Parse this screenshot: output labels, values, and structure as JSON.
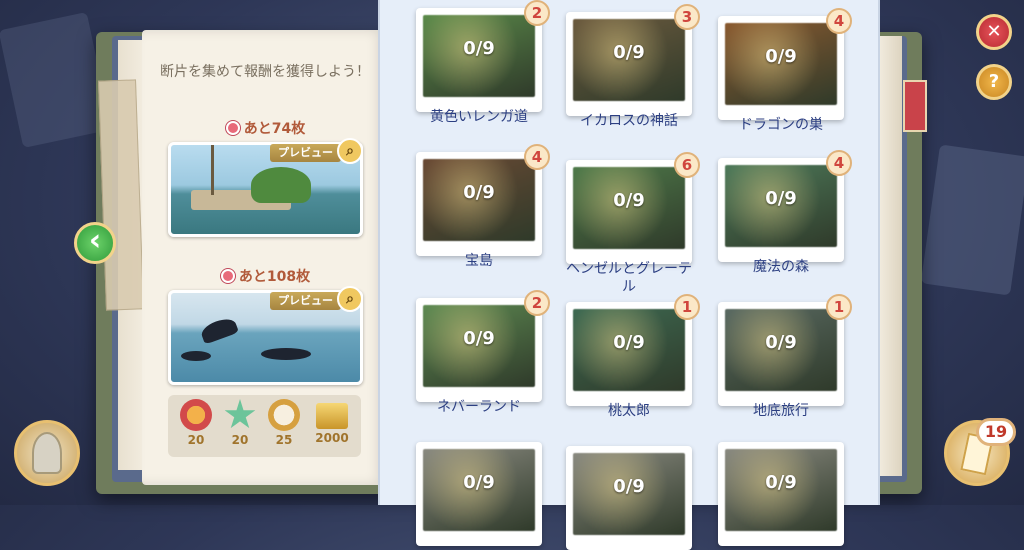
{
  "intro_text": "断片を集めて報酬を獲得しよう！",
  "packs": [
    {
      "count_label": "あと74枚",
      "preview_label": "プレビュー"
    },
    {
      "count_label": "あと108枚",
      "preview_label": "プレビュー"
    }
  ],
  "rewards": [
    {
      "icon": "mask-icon",
      "value": "20"
    },
    {
      "icon": "star-icon",
      "value": "20"
    },
    {
      "icon": "compass-icon",
      "value": "25"
    },
    {
      "icon": "gold-bars-icon",
      "value": "2000"
    }
  ],
  "puzzles": [
    {
      "title": "黄色いレンガ道",
      "progress": "0/9",
      "badge": "2",
      "color": "#5b8a4a"
    },
    {
      "title": "イカロスの神話",
      "progress": "0/9",
      "badge": "3",
      "color": "#6b5a3e"
    },
    {
      "title": "ドラゴンの巣",
      "progress": "0/9",
      "badge": "4",
      "color": "#8a5a30"
    },
    {
      "title": "宝島",
      "progress": "0/9",
      "badge": "4",
      "color": "#6a4a34"
    },
    {
      "title": "ヘンゼルとグレーテル",
      "progress": "0/9",
      "badge": "6",
      "color": "#4f7a4a"
    },
    {
      "title": "魔法の森",
      "progress": "0/9",
      "badge": "4",
      "color": "#4e7a5a"
    },
    {
      "title": "ネバーランド",
      "progress": "0/9",
      "badge": "2",
      "color": "#5e8a52"
    },
    {
      "title": "桃太郎",
      "progress": "0/9",
      "badge": "1",
      "color": "#3e6a52"
    },
    {
      "title": "地底旅行",
      "progress": "0/9",
      "badge": "1",
      "color": "#5a6a62"
    },
    {
      "title": "",
      "progress": "0/9",
      "badge": "",
      "color": "#8a8a80"
    },
    {
      "title": "",
      "progress": "0/9",
      "badge": "",
      "color": "#8a8a80"
    },
    {
      "title": "",
      "progress": "0/9",
      "badge": "",
      "color": "#8a8a80"
    }
  ],
  "buttons": {
    "close": "✕",
    "help": "?",
    "back": "‹",
    "cards_count": "19"
  },
  "colors": {
    "accent_gold": "#e2b04a",
    "title_blue": "#2c3f82",
    "badge_red": "#d0463e"
  }
}
